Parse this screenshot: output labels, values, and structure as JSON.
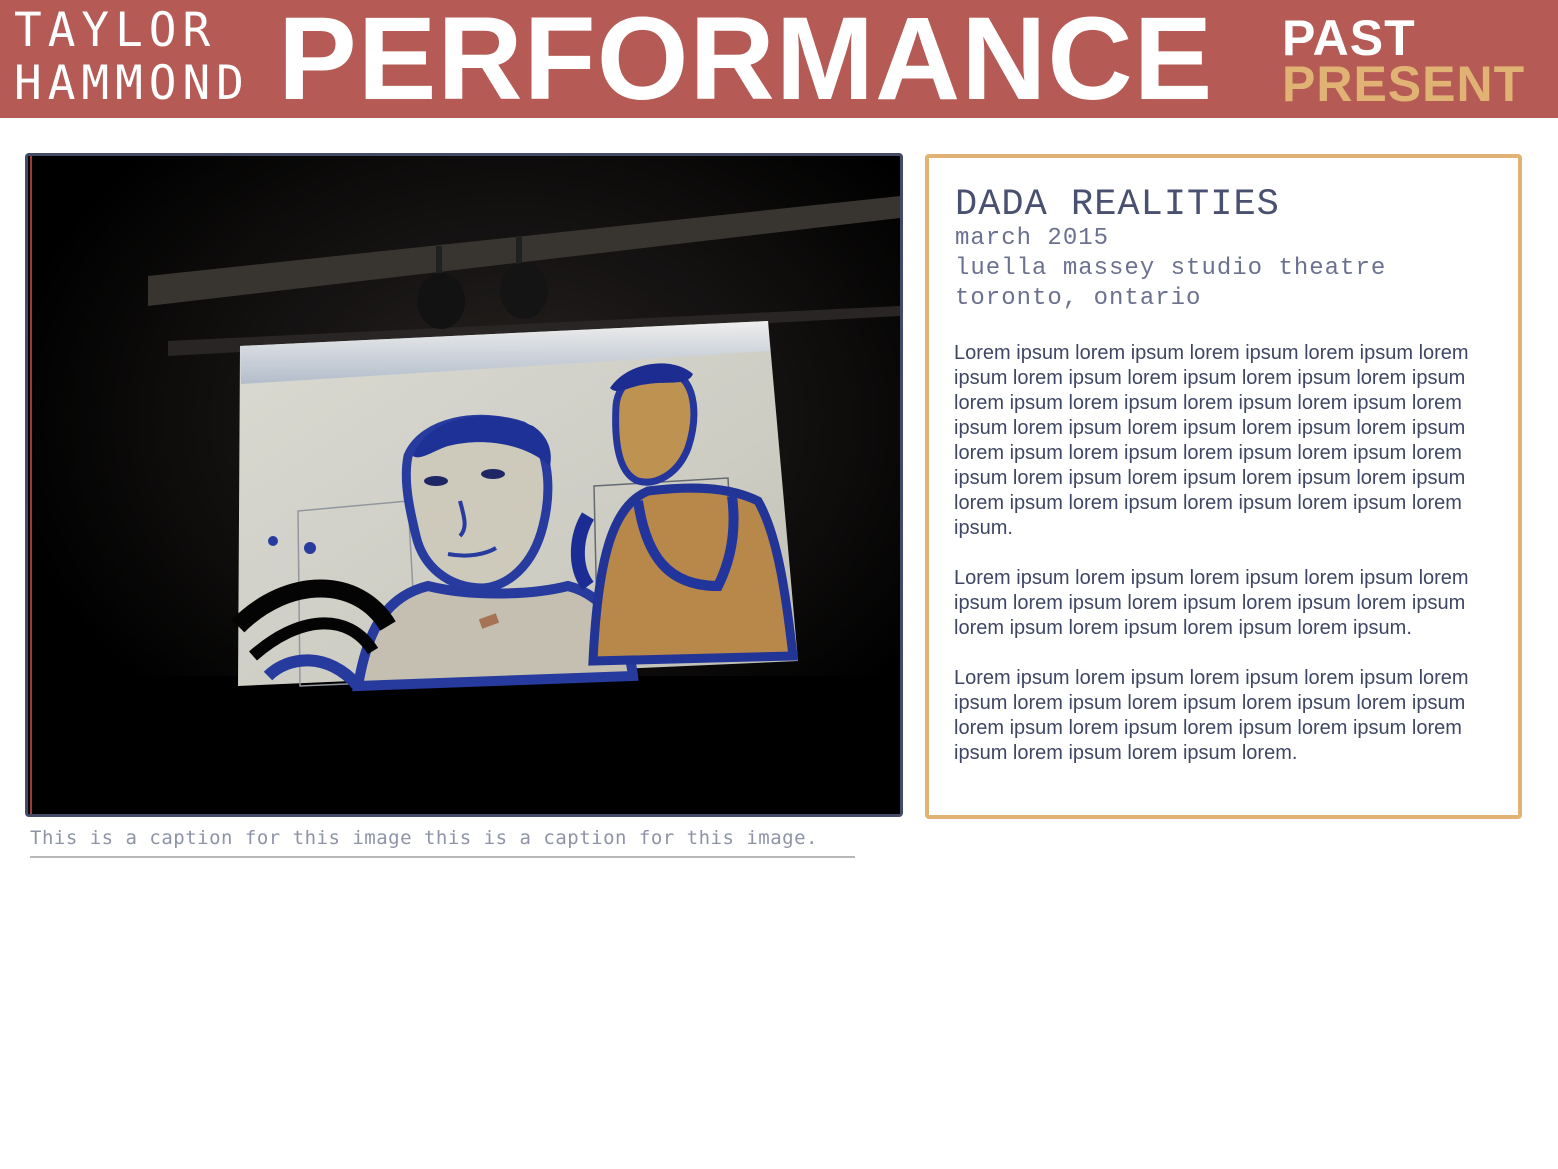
{
  "header": {
    "brand_line1": "TAYLOR",
    "brand_line2": "HAMMOND",
    "title": "PERFORMANCE",
    "subtitle_top": "PAST",
    "subtitle_bottom": "PRESENT",
    "colors": {
      "banner": "#b55a54",
      "accent": "#e0b375"
    }
  },
  "photo": {
    "caption": "This is a caption for this image this is a caption for this image."
  },
  "event": {
    "title": "DADA REALITIES",
    "date": "march 2015",
    "venue": "luella massey studio theatre",
    "location": "toronto, ontario",
    "paragraphs": [
      "Lorem ipsum lorem ipsum lorem ipsum lorem ipsum lorem ipsum lorem ipsum lorem ipsum lorem ipsum lorem ipsum lorem ipsum lorem ipsum lorem ipsum lorem ipsum lorem ipsum lorem ipsum lorem ipsum lorem ipsum lorem ipsum lorem ipsum lorem ipsum lorem ipsum lorem ipsum lorem ipsum lorem ipsum lorem ipsum lorem ipsum lorem ipsum lorem ipsum lorem ipsum lorem ipsum lorem ipsum lorem ipsum.",
      "Lorem ipsum lorem ipsum lorem ipsum lorem ipsum lorem ipsum lorem ipsum lorem ipsum lorem ipsum lorem ipsum lorem ipsum lorem ipsum lorem ipsum lorem ipsum.",
      "Lorem ipsum lorem ipsum lorem ipsum lorem ipsum lorem ipsum lorem ipsum lorem ipsum lorem ipsum lorem ipsum lorem ipsum lorem ipsum lorem ipsum lorem ipsum lorem ipsum lorem ipsum lorem ipsum lorem."
    ]
  }
}
